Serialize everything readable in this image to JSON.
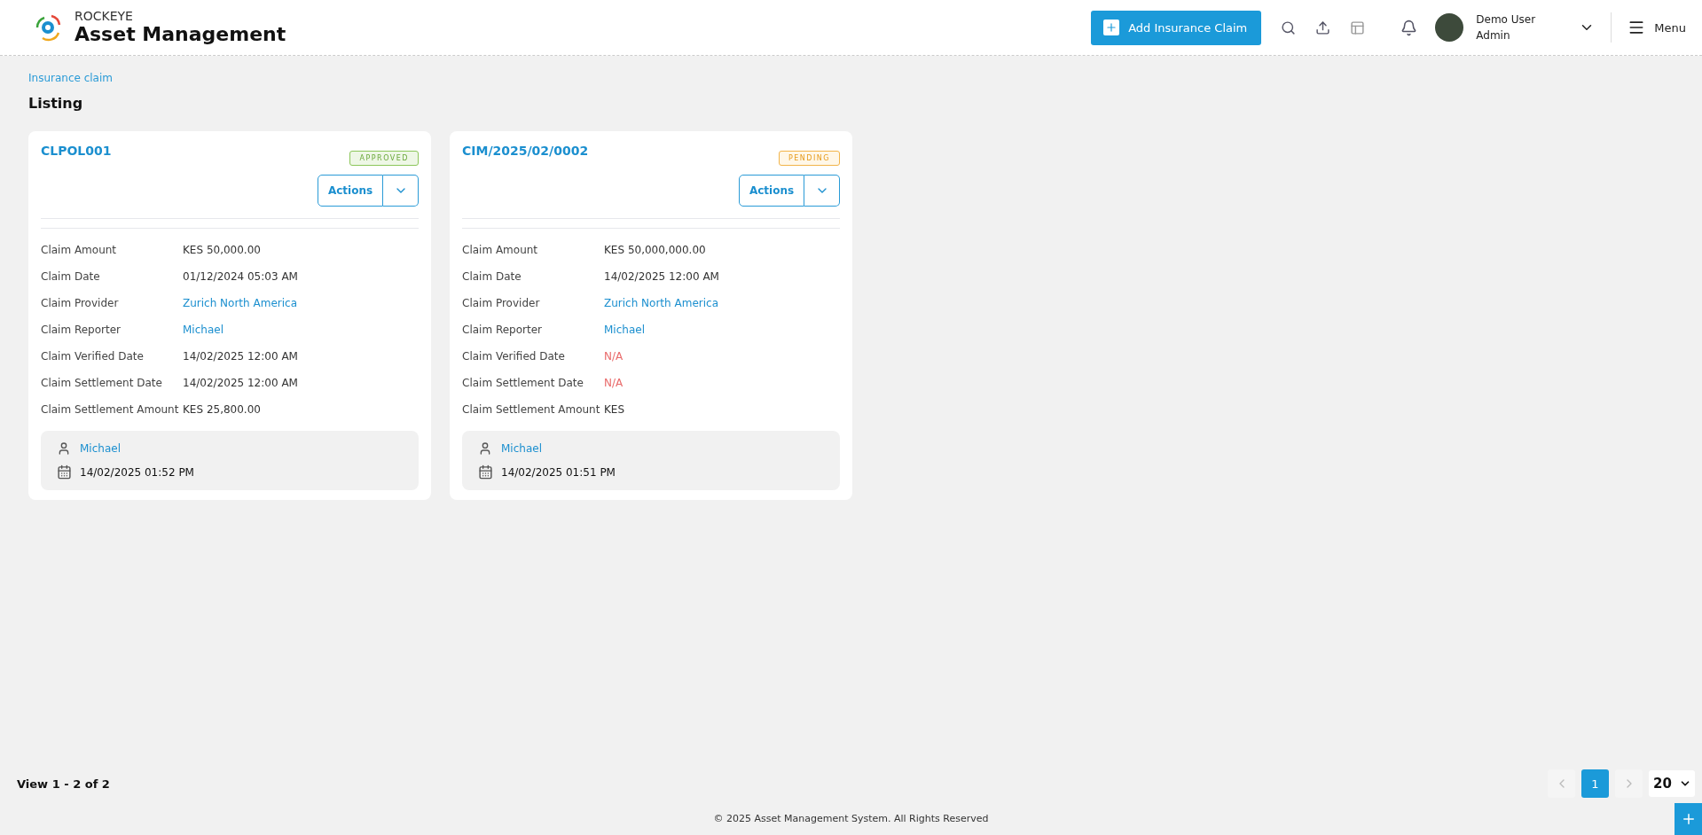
{
  "header": {
    "brand_top": "ROCKEYE",
    "brand_title": "Asset Management",
    "add_button": "Add Insurance Claim",
    "user_name": "Demo User",
    "user_role": "Admin",
    "menu_label": "Menu"
  },
  "breadcrumb": "Insurance claim",
  "page_title": "Listing",
  "cards": [
    {
      "code": "CLPOL001",
      "status": {
        "label": "APPROVED",
        "kind": "approved"
      },
      "actions_label": "Actions",
      "fields": [
        {
          "label": "Claim Amount",
          "value": "KES 50,000.00",
          "kind": "plain"
        },
        {
          "label": "Claim Date",
          "value": "01/12/2024 05:03 AM",
          "kind": "plain"
        },
        {
          "label": "Claim Provider",
          "value": "Zurich North America",
          "kind": "link"
        },
        {
          "label": "Claim Reporter",
          "value": "Michael",
          "kind": "link"
        },
        {
          "label": "Claim Verified Date",
          "value": "14/02/2025 12:00 AM",
          "kind": "plain"
        },
        {
          "label": "Claim Settlement Date",
          "value": "14/02/2025 12:00 AM",
          "kind": "plain"
        },
        {
          "label": "Claim Settlement Amount",
          "value": "KES 25,800.00",
          "kind": "plain"
        }
      ],
      "created_by": "Michael",
      "created_at": "14/02/2025 01:52 PM"
    },
    {
      "code": "CIM/2025/02/0002",
      "status": {
        "label": "PENDING",
        "kind": "pending"
      },
      "actions_label": "Actions",
      "fields": [
        {
          "label": "Claim Amount",
          "value": "KES 50,000,000.00",
          "kind": "plain"
        },
        {
          "label": "Claim Date",
          "value": "14/02/2025 12:00 AM",
          "kind": "plain"
        },
        {
          "label": "Claim Provider",
          "value": "Zurich North America",
          "kind": "link"
        },
        {
          "label": "Claim Reporter",
          "value": "Michael",
          "kind": "link"
        },
        {
          "label": "Claim Verified Date",
          "value": "N/A",
          "kind": "missing"
        },
        {
          "label": "Claim Settlement Date",
          "value": "N/A",
          "kind": "missing"
        },
        {
          "label": "Claim Settlement Amount",
          "value": "KES",
          "kind": "plain"
        }
      ],
      "created_by": "Michael",
      "created_at": "14/02/2025 01:51 PM"
    }
  ],
  "pagination": {
    "summary": "View 1 - 2 of 2",
    "pages": [
      {
        "label": "1",
        "selected": true
      }
    ],
    "page_size": "20"
  },
  "footer": "© 2025 Asset Management System. All Rights Reserved"
}
